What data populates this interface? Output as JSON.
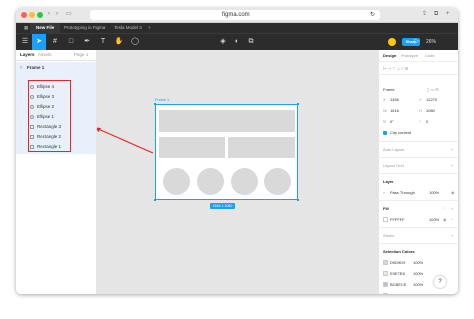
{
  "browser": {
    "url": "figma.com"
  },
  "figma": {
    "tabs": [
      {
        "label": "New File"
      },
      {
        "label": "Prototyping in Figma"
      },
      {
        "label": "Tesla Model 3"
      },
      {
        "label": "+"
      }
    ],
    "toolbar": {
      "share_label": "Share",
      "zoom_label": "26%"
    }
  },
  "left_panel": {
    "tabs": {
      "layers": "Layers",
      "assets": "Assets",
      "page": "Page 1"
    },
    "frame_label": "Frame 1",
    "layers": [
      {
        "label": "Ellipse 4",
        "kind": "ellipse"
      },
      {
        "label": "Ellipse 3",
        "kind": "ellipse"
      },
      {
        "label": "Ellipse 2",
        "kind": "ellipse"
      },
      {
        "label": "Ellipse 1",
        "kind": "ellipse"
      },
      {
        "label": "Rectangle 3",
        "kind": "rect"
      },
      {
        "label": "Rectangle 2",
        "kind": "rect"
      },
      {
        "label": "Rectangle 1",
        "kind": "rect"
      }
    ]
  },
  "canvas": {
    "frame_label": "Frame 1",
    "size_badge": "1616 × 1080"
  },
  "right_panel": {
    "tabs": {
      "design": "Design",
      "prototype": "Prototype",
      "code": "Code"
    },
    "frame_type": "Frame",
    "x": "1456",
    "y": "12270",
    "w": "1616",
    "h": "1080",
    "rotation": "0°",
    "radius": "0",
    "clip_content": "Clip content",
    "auto_layout": "Auto Layout",
    "layout_grid": "Layout Grid",
    "layer_heading": "Layer",
    "blend_mode": "Pass Through",
    "opacity": "100%",
    "fill_heading": "Fill",
    "fill_hex": "FFFFFF",
    "fill_opacity": "100%",
    "stroke_heading": "Stroke",
    "selection_colors_heading": "Selection Colors",
    "selection_colors": [
      {
        "hex": "D9D9D9",
        "opacity": "100%",
        "color": "#d9d9d9"
      },
      {
        "hex": "E9E7E8",
        "opacity": "100%",
        "color": "#e9e7e8"
      },
      {
        "hex": "BCBECE",
        "opacity": "100%",
        "color": "#bcbece"
      },
      {
        "hex": "FFFFFF",
        "opacity": "100%",
        "color": "#ffffff"
      }
    ]
  },
  "help_label": "?"
}
